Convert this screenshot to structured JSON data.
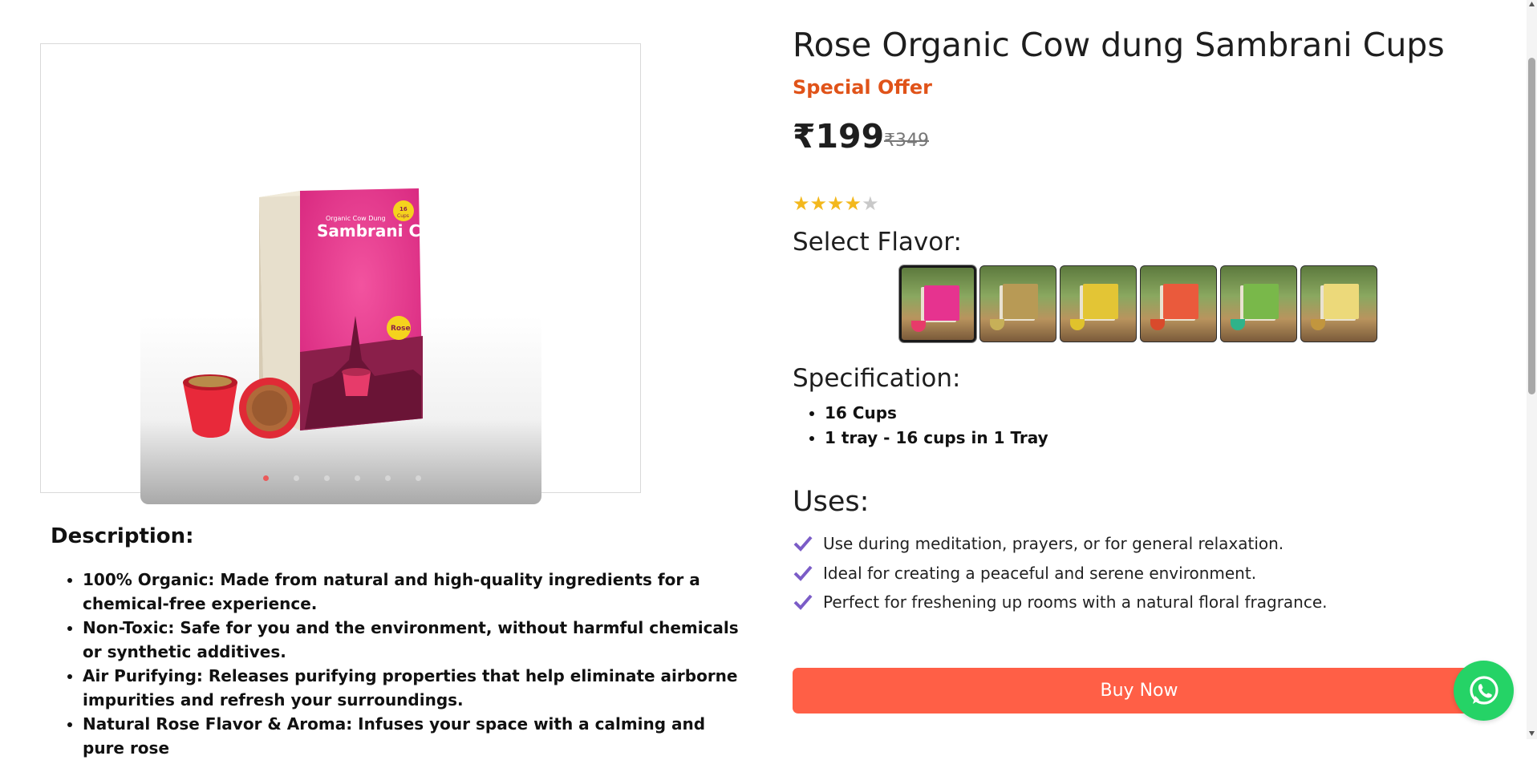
{
  "product": {
    "title": "Rose Organic Cow dung Sambrani Cups",
    "offer_label": "Special Offer",
    "price": "₹199",
    "mrp": "₹349",
    "rating": 4,
    "rating_max": 5
  },
  "gallery": {
    "image_texts": {
      "box_title_small": "Organic Cow Dung",
      "box_title": "Sambrani Cups",
      "badge_count": "16",
      "badge_unit": "Cups",
      "flavor_badge": "Rose"
    },
    "dot_count": 6,
    "active_dot": 0
  },
  "flavor": {
    "heading": "Select Flavor:",
    "options": [
      {
        "box_color": "#e6338f",
        "cup_color": "#e73b6a",
        "selected": true
      },
      {
        "box_color": "#b89a55",
        "cup_color": "#c7b058",
        "selected": false
      },
      {
        "box_color": "#e3c535",
        "cup_color": "#e0c22c",
        "selected": false
      },
      {
        "box_color": "#ea5a3c",
        "cup_color": "#d94a2c",
        "selected": false
      },
      {
        "box_color": "#79b84a",
        "cup_color": "#2fb38a",
        "selected": false
      },
      {
        "box_color": "#ecd97a",
        "cup_color": "#c2963e",
        "selected": false
      }
    ]
  },
  "specification": {
    "heading": "Specification:",
    "items": [
      "16 Cups",
      "1 tray - 16 cups in 1 Tray"
    ]
  },
  "uses": {
    "heading": "Uses:",
    "items": [
      "Use during meditation, prayers, or for general relaxation.",
      "Ideal for creating a peaceful and serene environment.",
      "Perfect for freshening up rooms with a natural floral fragrance."
    ]
  },
  "description": {
    "heading": "Description:",
    "items": [
      "100% Organic: Made from natural and high-quality ingredients for a chemical-free experience.",
      "Non-Toxic: Safe for you and the environment, without harmful chemicals or synthetic additives.",
      "Air Purifying: Releases purifying properties that help eliminate airborne impurities and refresh your surroundings.",
      "Natural Rose Flavor & Aroma: Infuses your space with a calming and pure rose"
    ]
  },
  "actions": {
    "buy_label": "Buy Now"
  },
  "icons": {
    "fab": "whatsapp-icon",
    "bullet_check": "check-icon",
    "rating": "star-icon"
  },
  "colors": {
    "offer": "#e05319",
    "buy_button": "#ff5f46",
    "star": "#f3b81d",
    "check": "#7b5cc7",
    "whatsapp": "#25d366"
  }
}
